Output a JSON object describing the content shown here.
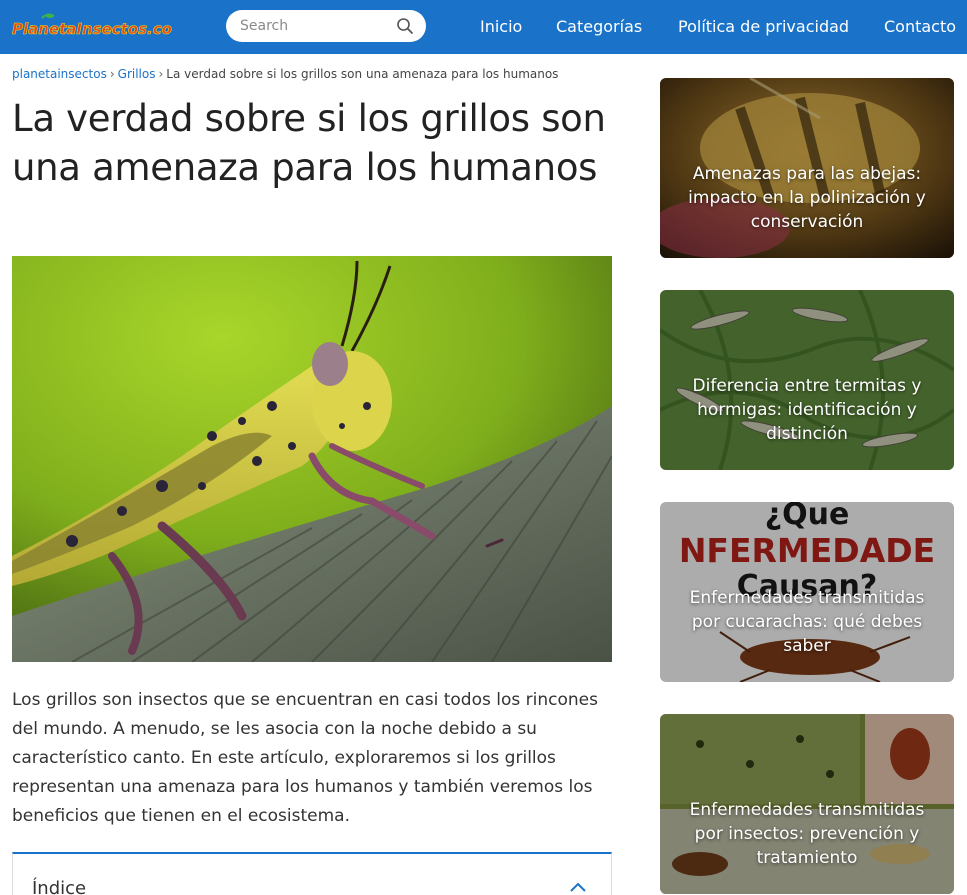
{
  "header": {
    "logo_text": "PlanetaInsectos.com",
    "search": {
      "placeholder": "Search"
    },
    "nav": [
      "Inicio",
      "Categorías",
      "Política de privacidad",
      "Contacto"
    ]
  },
  "breadcrumb": {
    "items": [
      "planetainsectos",
      "Grillos",
      "La verdad sobre si los grillos son una amenaza para los humanos"
    ],
    "separator": "›"
  },
  "article": {
    "title": "La verdad sobre si los grillos son una amenaza para los humanos",
    "intro": "Los grillos son insectos que se encuentran en casi todos los rincones del mundo. A menudo, se les asocia con la noche debido a su característico canto. En este artículo, exploraremos si los grillos representan una amenaza para los humanos y también veremos los beneficios que tienen en el ecosistema.",
    "toc_title": "Índice"
  },
  "sidebar": {
    "cards": [
      {
        "title": "Amenazas para las abejas: impacto en la polinización y conservación"
      },
      {
        "title": "Diferencia entre termitas y hormigas: identificación y distinción"
      },
      {
        "title": "Enfermedades transmitidas por cucarachas: qué debes saber",
        "image_text": [
          "¿Que",
          "NFERMEDADE",
          "Causan?"
        ]
      },
      {
        "title": "Enfermedades transmitidas por insectos: prevención y tratamiento"
      }
    ]
  },
  "colors": {
    "header_bg": "#1a73c9",
    "link": "#1a73c9",
    "logo_primary": "#e0491e",
    "logo_secondary": "#f4d21b"
  }
}
